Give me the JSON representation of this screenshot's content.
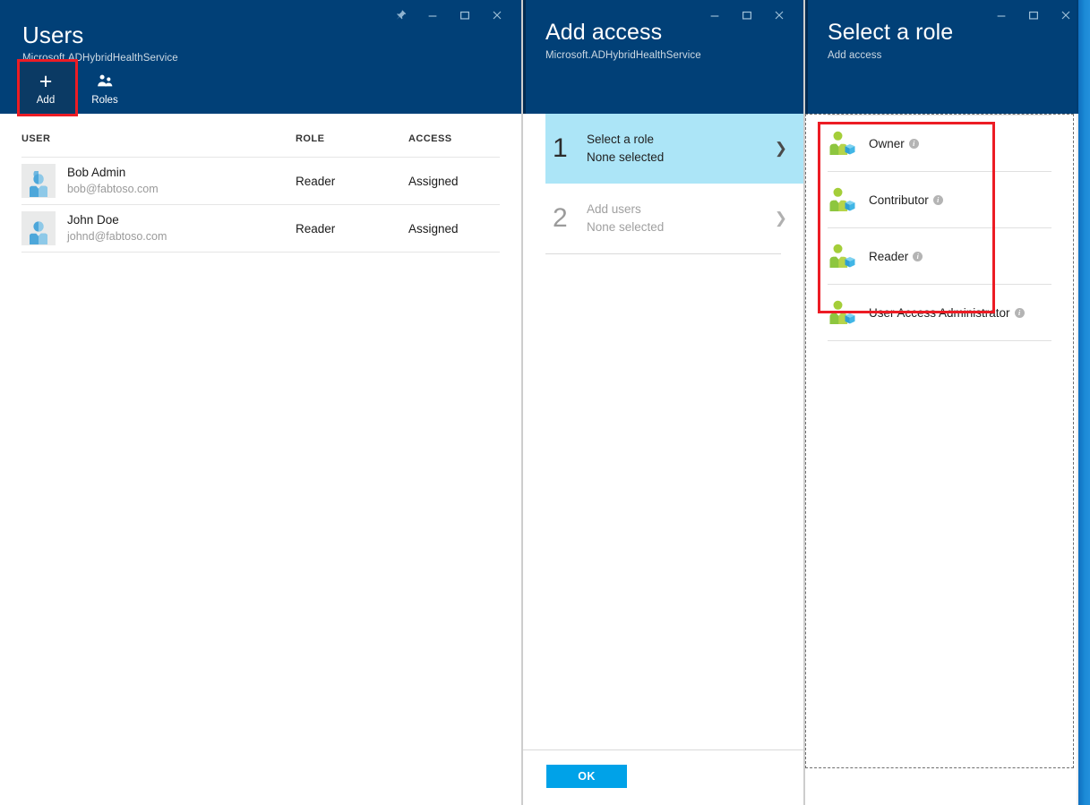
{
  "blades": {
    "users": {
      "title": "Users",
      "subtitle": "Microsoft.ADHybridHealthService",
      "window_controls": [
        "pin-icon",
        "minimize-icon",
        "maximize-icon",
        "close-icon"
      ],
      "toolbar": [
        {
          "label": "Add",
          "icon": "plus-icon",
          "active": true
        },
        {
          "label": "Roles",
          "icon": "roles-icon",
          "active": false
        }
      ],
      "table": {
        "columns": [
          "USER",
          "ROLE",
          "ACCESS"
        ],
        "rows": [
          {
            "name": "Bob Admin",
            "email": "bob@fabtoso.com",
            "role": "Reader",
            "access": "Assigned",
            "avatar": "user-avatar-icon"
          },
          {
            "name": "John Doe",
            "email": "johnd@fabtoso.com",
            "role": "Reader",
            "access": "Assigned",
            "avatar": "user-avatar-icon"
          }
        ]
      }
    },
    "add_access": {
      "title": "Add access",
      "subtitle": "Microsoft.ADHybridHealthService",
      "window_controls": [
        "minimize-icon",
        "maximize-icon",
        "close-icon"
      ],
      "steps": [
        {
          "num": "1",
          "title": "Select a role",
          "sub": "None selected",
          "state": "selected",
          "chevron": "chevron-right-icon"
        },
        {
          "num": "2",
          "title": "Add users",
          "sub": "None selected",
          "state": "disabled",
          "chevron": "chevron-right-icon"
        }
      ],
      "ok_label": "OK"
    },
    "select_role": {
      "title": "Select a role",
      "subtitle": "Add access",
      "window_controls": [
        "minimize-icon",
        "maximize-icon",
        "close-icon"
      ],
      "roles": [
        {
          "label": "Owner",
          "icon": "role-user-resource-icon",
          "info": "i"
        },
        {
          "label": "Contributor",
          "icon": "role-user-resource-icon",
          "info": "i"
        },
        {
          "label": "Reader",
          "icon": "role-user-resource-icon",
          "info": "i"
        },
        {
          "label": "User Access Administrator",
          "icon": "role-user-resource-icon",
          "info": "i"
        }
      ]
    }
  },
  "annotations": {
    "highlight_add_button": "red-highlight-box",
    "highlight_role_group": "red-highlight-box"
  },
  "colors": {
    "blade_header": "#014077",
    "accent_blue": "#00a2e8",
    "step_selected": "#ace5f7",
    "highlight_red": "#ec1c24",
    "avatar_blue": "#6fb7e0",
    "role_green": "#a4ce39",
    "role_cube_blue": "#41b6e6"
  }
}
